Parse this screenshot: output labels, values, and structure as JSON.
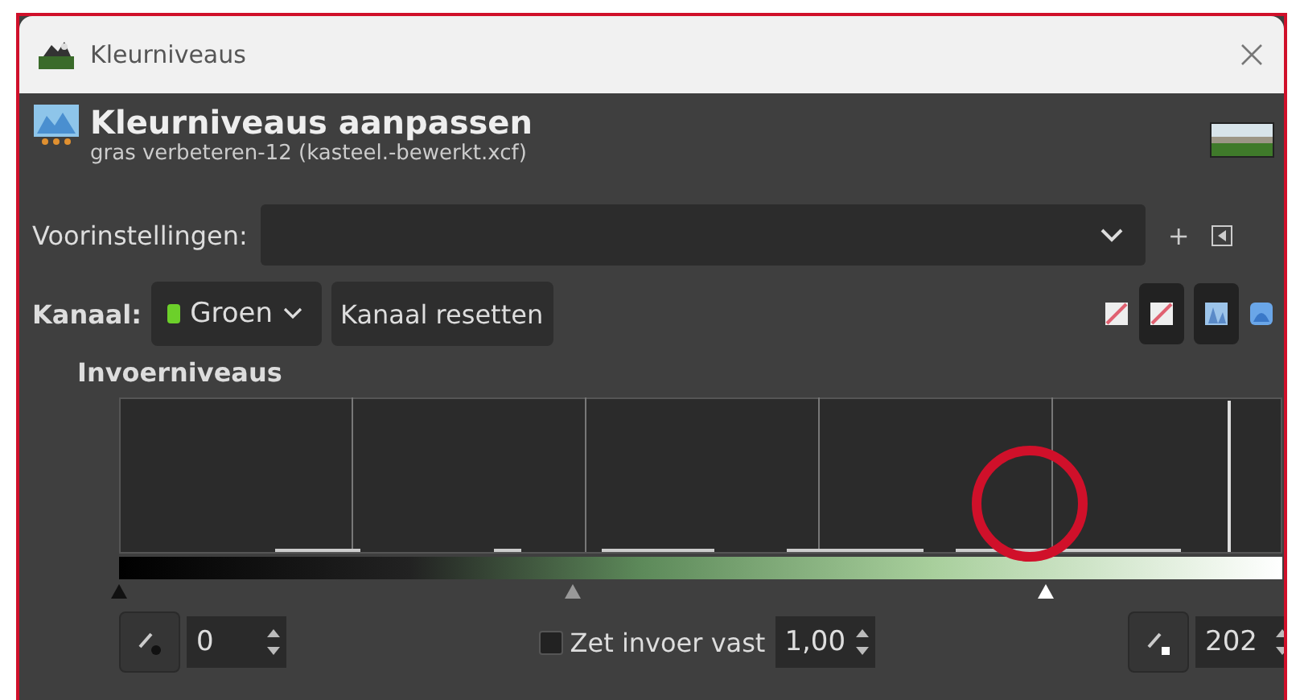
{
  "window": {
    "title": "Kleurniveaus"
  },
  "header": {
    "title": "Kleurniveaus aanpassen",
    "subtitle": "gras verbeteren-12 (kasteel.-bewerkt.xcf)"
  },
  "presets": {
    "label": "Voorinstellingen:",
    "add": "+"
  },
  "channel": {
    "label": "Kanaal:",
    "value": "Groen",
    "reset_button": "Kanaal resetten"
  },
  "input_levels": {
    "title": "Invoerniveaus",
    "handles": [
      {
        "kind": "black",
        "level": 0
      },
      {
        "kind": "gamma",
        "level": 0.39
      },
      {
        "kind": "white",
        "level": 0.796
      }
    ],
    "low_value": "0",
    "clamp": {
      "label": "Zet invoer vast",
      "checked": false
    },
    "gamma_value": "1,00",
    "high_value": "202"
  }
}
